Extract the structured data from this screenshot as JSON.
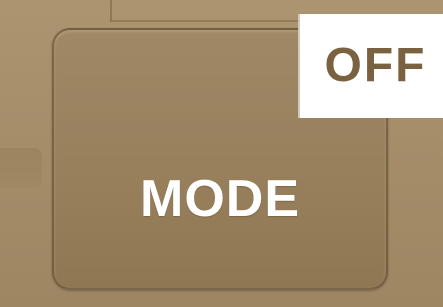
{
  "controls": {
    "mode_button": {
      "label": "MODE"
    },
    "status": {
      "label": "OFF"
    }
  },
  "colors": {
    "panel": "#a58d6a",
    "button": "#977f5c",
    "status_background": "#ffffff",
    "status_text": "#7a6241",
    "label_text": "#ffffff"
  }
}
